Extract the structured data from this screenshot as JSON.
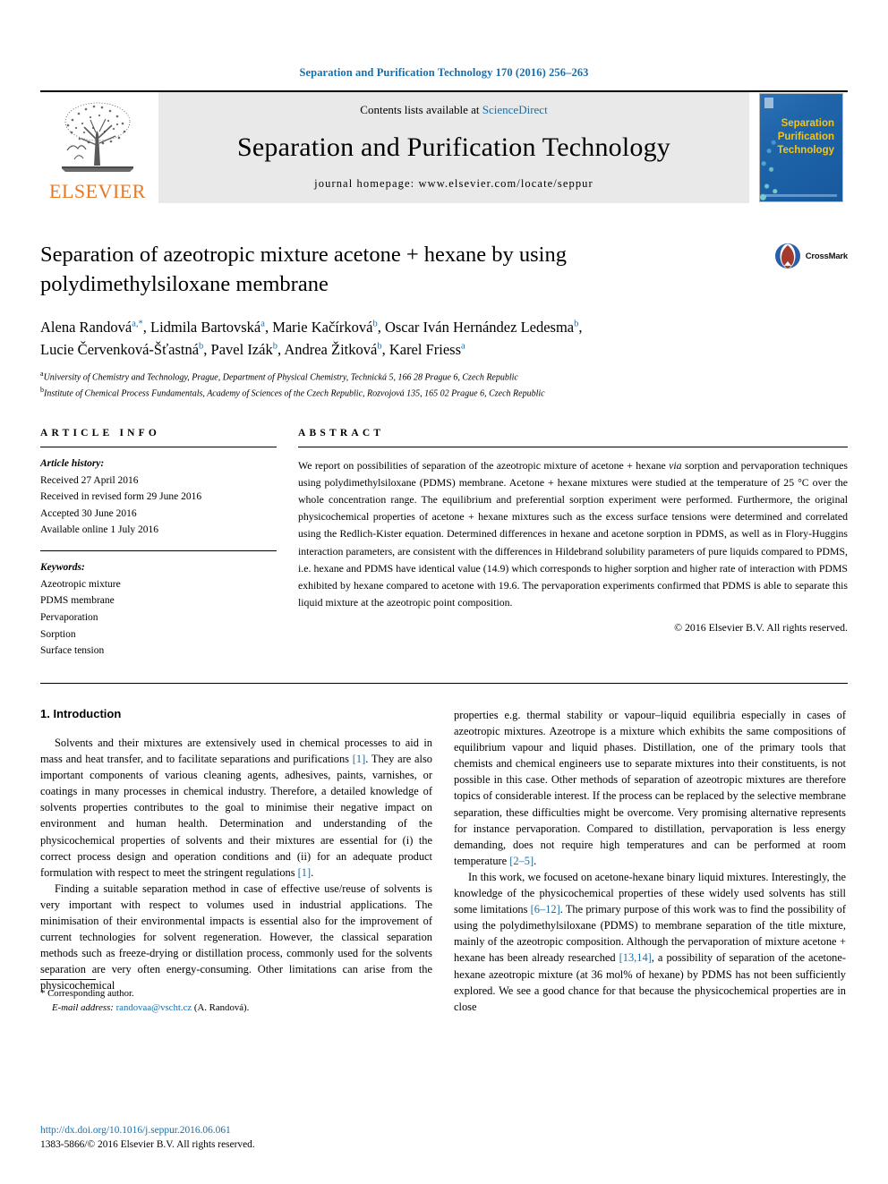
{
  "running_head": "Separation and Purification Technology 170 (2016) 256–263",
  "masthead": {
    "publisher": "ELSEVIER",
    "contents_prefix": "Contents lists available at",
    "contents_link": "ScienceDirect",
    "journal_title": "Separation and Purification Technology",
    "homepage": "journal homepage: www.elsevier.com/locate/seppur",
    "cover_title_lines": [
      "Separation",
      "Purification",
      "Technology"
    ]
  },
  "title": "Separation of azeotropic mixture acetone + hexane by using polydimethylsiloxane membrane",
  "crossmark_label": "CrossMark",
  "authors_line_1": "Alena Randová",
  "authors": [
    {
      "name": "Alena Randová",
      "sup": "a,*"
    },
    {
      "name": "Lidmila Bartovská",
      "sup": "a"
    },
    {
      "name": "Marie Kačírková",
      "sup": "b"
    },
    {
      "name": "Oscar Iván Hernández Ledesma",
      "sup": "b"
    },
    {
      "name": "Lucie Červenková-Šťastná",
      "sup": "b"
    },
    {
      "name": "Pavel Izák",
      "sup": "b"
    },
    {
      "name": "Andrea Žitková",
      "sup": "b"
    },
    {
      "name": "Karel Friess",
      "sup": "a"
    }
  ],
  "affiliations": [
    {
      "sup": "a",
      "text": "University of Chemistry and Technology, Prague, Department of Physical Chemistry, Technická 5, 166 28 Prague 6, Czech Republic"
    },
    {
      "sup": "b",
      "text": "Institute of Chemical Process Fundamentals, Academy of Sciences of the Czech Republic, Rozvojová 135, 165 02 Prague 6, Czech Republic"
    }
  ],
  "article_info": {
    "label": "ARTICLE INFO",
    "history_label": "Article history:",
    "history": [
      "Received 27 April 2016",
      "Received in revised form 29 June 2016",
      "Accepted 30 June 2016",
      "Available online 1 July 2016"
    ],
    "keywords_label": "Keywords:",
    "keywords": [
      "Azeotropic mixture",
      "PDMS membrane",
      "Pervaporation",
      "Sorption",
      "Surface tension"
    ]
  },
  "abstract": {
    "label": "ABSTRACT",
    "part1": "We report on possibilities of separation of the azeotropic mixture of acetone + hexane ",
    "via": "via",
    "part2": " sorption and pervaporation techniques using polydimethylsiloxane (PDMS) membrane. Acetone + hexane mixtures were studied at the temperature of 25 °C over the whole concentration range. The equilibrium and preferential sorption experiment were performed. Furthermore, the original physicochemical properties of acetone + hexane mixtures such as the excess surface tensions were determined and correlated using the Redlich-Kister equation. Determined differences in hexane and acetone sorption in PDMS, as well as in Flory-Huggins interaction parameters, are consistent with the differences in Hildebrand solubility parameters of pure liquids compared to PDMS, i.e. hexane and PDMS have identical value (14.9) which corresponds to higher sorption and higher rate of interaction with PDMS exhibited by hexane compared to acetone with 19.6. The pervaporation experiments confirmed that PDMS is able to separate this liquid mixture at the azeotropic point composition.",
    "copyright": "© 2016 Elsevier B.V. All rights reserved."
  },
  "introduction": {
    "heading": "1. Introduction",
    "left_paragraphs": [
      {
        "segments": [
          {
            "t": "Solvents and their mixtures are extensively used in chemical processes to aid in mass and heat transfer, and to facilitate separations and purifications "
          },
          {
            "t": "[1]",
            "ref": true
          },
          {
            "t": ". They are also important components of various cleaning agents, adhesives, paints, varnishes, or coatings in many processes in chemical industry. Therefore, a detailed knowledge of solvents properties contributes to the goal to minimise their negative impact on environment and human health. Determination and understanding of the physicochemical properties of solvents and their mixtures are essential for (i) the correct process design and operation conditions and (ii) for an adequate product formulation with respect to meet the stringent regulations "
          },
          {
            "t": "[1]",
            "ref": true
          },
          {
            "t": "."
          }
        ]
      },
      {
        "segments": [
          {
            "t": "Finding a suitable separation method in case of effective use/reuse of solvents is very important with respect to volumes used in industrial applications. The minimisation of their environmental impacts is essential also for the improvement of current technologies for solvent regeneration. However, the classical separation methods such as freeze-drying or distillation process, commonly used for the solvents separation are very often energy-consuming. Other limitations can arise from the physicochemical"
          }
        ]
      }
    ],
    "right_paragraphs": [
      {
        "segments": [
          {
            "t": "properties e.g. thermal stability or vapour–liquid equilibria especially in cases of azeotropic mixtures. Azeotrope is a mixture which exhibits the same compositions of equilibrium vapour and liquid phases. Distillation, one of the primary tools that chemists and chemical engineers use to separate mixtures into their constituents, is not possible in this case. Other methods of separation of azeotropic mixtures are therefore topics of considerable interest. If the process can be replaced by the selective membrane separation, these difficulties might be overcome. Very promising alternative represents for instance pervaporation. Compared to distillation, pervaporation is less energy demanding, does not require high temperatures and can be performed at room temperature "
          },
          {
            "t": "[2–5]",
            "ref": true
          },
          {
            "t": "."
          }
        ],
        "no_indent": true
      },
      {
        "segments": [
          {
            "t": "In this work, we focused on acetone-hexane binary liquid mixtures. Interestingly, the knowledge of the physicochemical properties of these widely used solvents has still some limitations "
          },
          {
            "t": "[6–12]",
            "ref": true
          },
          {
            "t": ". The primary purpose of this work was to find the possibility of using the polydimethylsiloxane (PDMS) to membrane separation of the title mixture, mainly of the azeotropic composition. Although the pervaporation of mixture acetone + hexane has been already researched "
          },
          {
            "t": "[13,14]",
            "ref": true
          },
          {
            "t": ", a possibility of separation of the acetone-hexane azeotropic mixture (at 36 mol% of hexane) by PDMS has not been sufficiently explored. We see a good chance for that because the physicochemical properties are in close"
          }
        ]
      }
    ]
  },
  "footnote": {
    "star": "*",
    "corresponding": "Corresponding author.",
    "email_label": "E-mail address:",
    "email": "randovaa@vscht.cz",
    "email_owner": "(A. Randová)."
  },
  "doi_block": {
    "doi": "http://dx.doi.org/10.1016/j.seppur.2016.06.061",
    "issn_line": "1383-5866/© 2016 Elsevier B.V. All rights reserved."
  },
  "colors": {
    "link": "#1a6ea8",
    "elsevier_orange": "#E87722",
    "cover_yellow": "#f4c518"
  }
}
